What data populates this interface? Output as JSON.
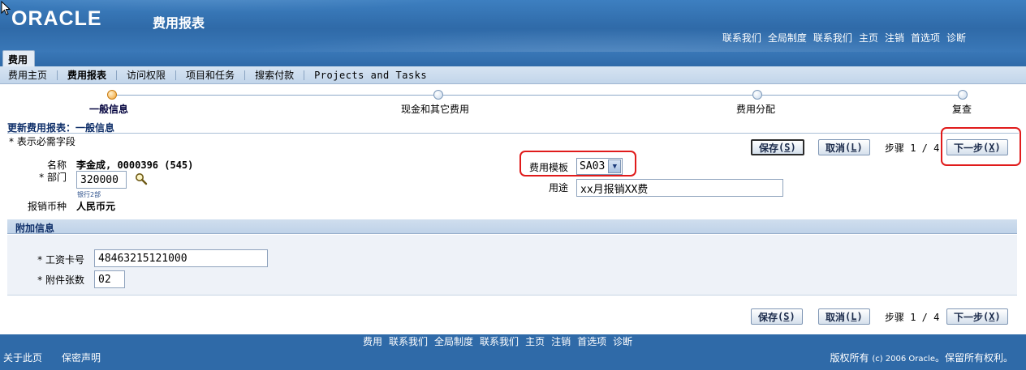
{
  "header": {
    "logo_text": "ORACLE",
    "app_title": "费用报表",
    "global_links": [
      "联系我们",
      "全局制度",
      "联系我们",
      "主页",
      "注销",
      "首选项",
      "诊断"
    ]
  },
  "tabs": {
    "active": "费用"
  },
  "subnav": {
    "items": [
      "费用主页",
      "费用报表",
      "访问权限",
      "项目和任务",
      "搜索付款",
      "Projects and Tasks"
    ],
    "active_index": 1
  },
  "train": {
    "steps": [
      "一般信息",
      "现金和其它费用",
      "费用分配",
      "复查"
    ],
    "current_index": 0
  },
  "page": {
    "title": "更新费用报表：一般信息",
    "required_note": "* 表示必需字段"
  },
  "buttons": {
    "save": "保存",
    "save_key": "S",
    "cancel": "取消",
    "cancel_key": "L",
    "next": "下一步",
    "next_key": "X",
    "step_text": "步骤 1 / 4"
  },
  "form": {
    "name_label": "名称",
    "name_value": "李金成, 0000396 (545)",
    "dept_label": "* 部门",
    "dept_value": "320000",
    "dept_hint": "银行2部",
    "currency_label": "报销币种",
    "currency_value": "人民币元",
    "template_label": "费用模板",
    "template_value": "SA03",
    "purpose_label": "用途",
    "purpose_value": "xx月报销XX费"
  },
  "additional": {
    "title": "附加信息",
    "card_label": "* 工资卡号",
    "card_value": "48463215121000",
    "attach_label": "* 附件张数",
    "attach_value": "02"
  },
  "footer": {
    "links": [
      "费用",
      "联系我们",
      "全局制度",
      "联系我们",
      "主页",
      "注销",
      "首选项",
      "诊断"
    ],
    "about": "关于此页",
    "privacy": "保密声明",
    "copyright_prefix": "版权所有",
    "copyright_mid": "(c) 2006 Oracle",
    "copyright_suffix": "。保留所有权利。"
  },
  "colors": {
    "header_blue": "#2f6aa8",
    "highlight_red": "#e01b1b",
    "train_current": "#f0a030"
  }
}
